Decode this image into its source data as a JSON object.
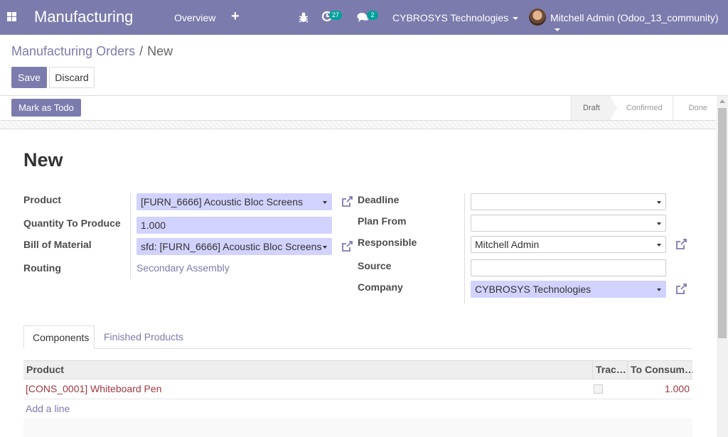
{
  "navbar": {
    "app_title": "Manufacturing",
    "menu_overview": "Overview",
    "menu_add": "+",
    "activity_count": "27",
    "message_count": "2",
    "company": "CYBROSYS Technologies",
    "user": "Mitchell Admin (Odoo_13_community)",
    "colors": {
      "primary": "#7c7bad",
      "badge": "#00a09d"
    }
  },
  "breadcrumb": {
    "parent": "Manufacturing Orders",
    "separator": "/",
    "current": "New"
  },
  "buttons": {
    "save": "Save",
    "discard": "Discard",
    "mark_todo": "Mark as Todo"
  },
  "statusbar": {
    "stages": [
      "Draft",
      "Confirmed",
      "Done"
    ],
    "current": "Draft"
  },
  "form": {
    "title": "New",
    "left": {
      "product_label": "Product",
      "product_value": "[FURN_6666] Acoustic Bloc Screens",
      "qty_label": "Quantity To Produce",
      "qty_value": "1.000",
      "bom_label": "Bill of Material",
      "bom_value": "sfd: [FURN_6666] Acoustic Bloc Screens",
      "routing_label": "Routing",
      "routing_value": "Secondary Assembly"
    },
    "right": {
      "deadline_label": "Deadline",
      "deadline_value": "",
      "plan_from_label": "Plan From",
      "plan_from_value": "",
      "responsible_label": "Responsible",
      "responsible_value": "Mitchell Admin",
      "source_label": "Source",
      "source_value": "",
      "company_label": "Company",
      "company_value": "CYBROSYS Technologies"
    }
  },
  "tabs": [
    {
      "label": "Components",
      "active": true
    },
    {
      "label": "Finished Products",
      "active": false
    }
  ],
  "components_table": {
    "headers": [
      "Product",
      "Trac…",
      "To Consum…"
    ],
    "rows": [
      {
        "product": "[CONS_0001] Whiteboard Pen",
        "tracked": false,
        "to_consume": "1.000"
      }
    ],
    "add_line": "Add a line"
  }
}
